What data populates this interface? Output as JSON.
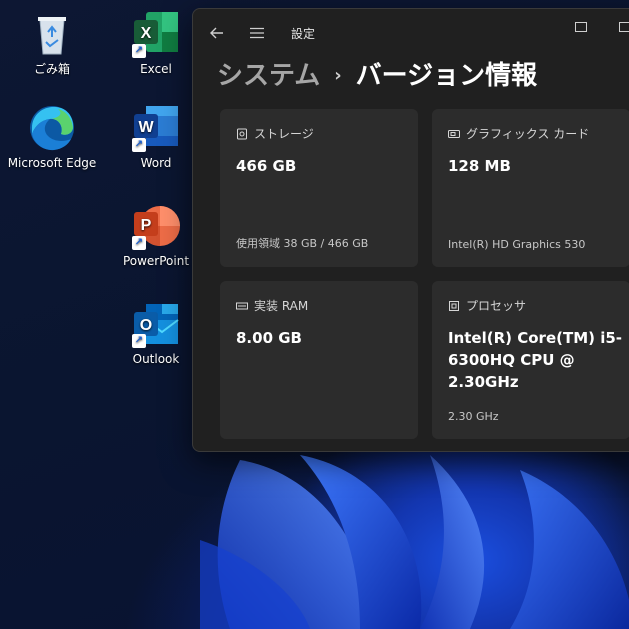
{
  "desktop": {
    "icons": [
      {
        "label": "ごみ箱",
        "icon": "recycle-bin-icon"
      },
      {
        "label": "Excel",
        "icon": "excel-icon",
        "letter": "X",
        "color": "#1d7a45"
      },
      {
        "label": "Microsoft Edge",
        "icon": "edge-icon"
      },
      {
        "label": "Word",
        "icon": "word-icon",
        "letter": "W",
        "color": "#1f5ab4"
      },
      {
        "label": "PowerPoint",
        "icon": "powerpoint-icon",
        "letter": "P",
        "color": "#c64322"
      },
      {
        "label": "Outlook",
        "icon": "outlook-icon",
        "letter": "O",
        "color": "#0a64b8"
      }
    ]
  },
  "window": {
    "title": "設定",
    "back_icon": "back-arrow-icon",
    "menu_icon": "hamburger-menu-icon",
    "breadcrumb": {
      "parent": "システム",
      "separator": "›",
      "current": "バージョン情報"
    },
    "cards": [
      {
        "title": "ストレージ",
        "icon": "storage-icon",
        "value": "466 GB",
        "detail": "使用領域 38 GB / 466 GB"
      },
      {
        "title": "グラフィックス カード",
        "icon": "graphics-card-icon",
        "value": "128 MB",
        "detail": "Intel(R) HD Graphics 530"
      },
      {
        "title": "実装 RAM",
        "icon": "ram-icon",
        "value": "8.00 GB",
        "detail": ""
      },
      {
        "title": "プロセッサ",
        "icon": "processor-icon",
        "value": "Intel(R) Core(TM) i5-6300HQ CPU @ 2.30GHz",
        "detail": "2.30 GHz"
      }
    ]
  },
  "colors": {
    "window_bg": "#202020",
    "card_bg": "#2c2c2c",
    "breadcrumb_parent": "#a6a6a6",
    "wallpaper_accent": "#1b4fe0"
  }
}
